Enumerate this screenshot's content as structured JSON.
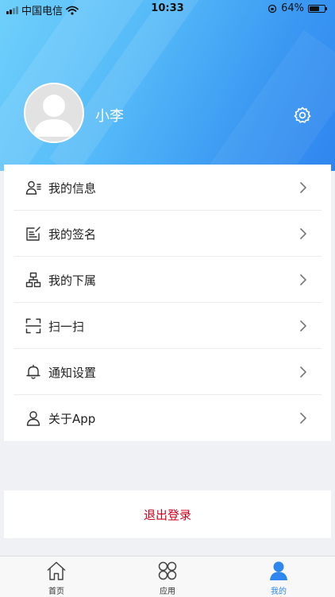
{
  "status_bar": {
    "carrier": "中国电信",
    "time": "10:33",
    "battery": "64%",
    "battery_level": 0.64
  },
  "profile": {
    "username": "小李"
  },
  "menu": {
    "items": [
      {
        "label": "我的信息",
        "icon": "user-info-icon"
      },
      {
        "label": "我的签名",
        "icon": "signature-icon"
      },
      {
        "label": "我的下属",
        "icon": "org-chart-icon"
      },
      {
        "label": "扫一扫",
        "icon": "scan-icon"
      },
      {
        "label": "通知设置",
        "icon": "bell-icon"
      },
      {
        "label": "关于App",
        "icon": "user-icon"
      }
    ]
  },
  "logout": {
    "label": "退出登录"
  },
  "tabbar": {
    "tabs": [
      {
        "label": "首页",
        "icon": "home-icon"
      },
      {
        "label": "应用",
        "icon": "apps-icon"
      },
      {
        "label": "我的",
        "icon": "profile-icon"
      }
    ]
  },
  "colors": {
    "accent": "#2f86ef",
    "logout_text": "#d0021b",
    "header_start": "#6fd0fb",
    "header_end": "#2f86ef"
  }
}
